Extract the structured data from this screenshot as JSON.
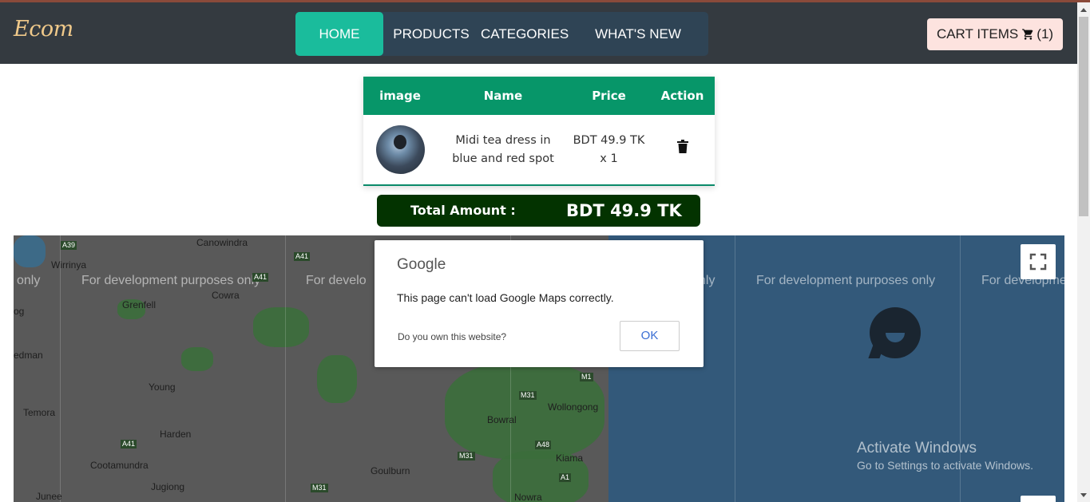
{
  "brand": {
    "logo_text": "Ecom"
  },
  "nav": {
    "items": [
      {
        "label": "HOME",
        "active": true
      },
      {
        "label": "PRODUCTS"
      },
      {
        "label": "CATEGORIES"
      },
      {
        "label": "WHAT'S NEW"
      }
    ]
  },
  "cart_button": {
    "label": "CART ITEMS",
    "count": "(1)",
    "icon": "shopping-cart-icon"
  },
  "cart_table": {
    "headers": [
      "image",
      "Name",
      "Price",
      "Action"
    ],
    "rows": [
      {
        "name": "Midi tea dress in blue and red spot",
        "price": "BDT 49.9 TK x 1",
        "action_icon": "trash-icon"
      }
    ]
  },
  "total": {
    "label": "Total Amount :",
    "value": "BDT 49.9 TK"
  },
  "map": {
    "dev_text": "For development purposes only",
    "dev_fragments": [
      "only",
      "For develo",
      "nly",
      "For developme"
    ],
    "places": [
      "Canowindra",
      "Wirrinya",
      "Grenfell",
      "Cowra",
      "Young",
      "Harden",
      "Temora",
      "Cootamundra",
      "Jugiong",
      "Goulburn",
      "Bowral",
      "Wollongong",
      "Kiama",
      "Nowra",
      "edman",
      "Junee",
      "og"
    ],
    "roads": [
      "A39",
      "A41",
      "A41",
      "A41",
      "M31",
      "M31",
      "M31",
      "A48",
      "M1",
      "A1"
    ]
  },
  "google_dialog": {
    "logo": "Google",
    "message": "This page can't load Google Maps correctly.",
    "question": "Do you own this website?",
    "ok_label": "OK"
  },
  "watermark": {
    "title": "Activate Windows",
    "subtitle": "Go to Settings to activate Windows."
  },
  "colors": {
    "navbar": "#343a40",
    "accent": "#1abc9c",
    "table_header": "#079669",
    "total_bar": "#033300",
    "cart_button": "#fde3df"
  }
}
